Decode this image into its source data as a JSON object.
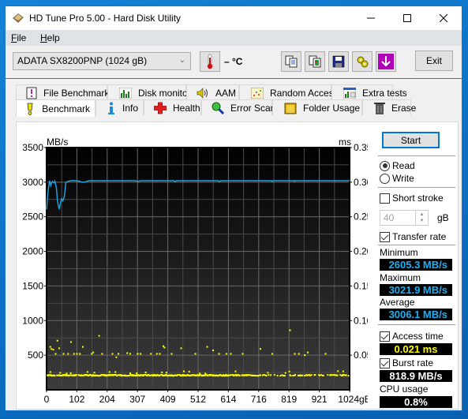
{
  "window": {
    "title": "HD Tune Pro 5.00 - Hard Disk Utility",
    "controls": {
      "minimize": "minimize",
      "maximize": "maximize",
      "close": "close"
    }
  },
  "menu": [
    {
      "label": "File",
      "accel": "F"
    },
    {
      "label": "Help",
      "accel": "H"
    }
  ],
  "toolbar": {
    "drive": "ADATA SX8200PNP (1024 gB)",
    "temperature": "– °C",
    "icons": [
      "thermometer-icon",
      "copy-text-icon",
      "copy-screenshot-icon",
      "save-icon",
      "options-icon",
      "download-icon"
    ],
    "exit_label": "Exit"
  },
  "tabs": {
    "row1": [
      "File Benchmark",
      "Disk monitor",
      "AAM",
      "Random Access",
      "Extra tests"
    ],
    "row2": [
      "Benchmark",
      "Info",
      "Health",
      "Error Scan",
      "Folder Usage",
      "Erase"
    ],
    "active": "Benchmark"
  },
  "side": {
    "start_label": "Start",
    "read_label": "Read",
    "write_label": "Write",
    "mode": "Read",
    "short_stroke_label": "Short stroke",
    "short_stroke_checked": false,
    "short_stroke_value": "40",
    "short_stroke_unit": "gB",
    "transfer_rate_label": "Transfer rate",
    "transfer_rate_checked": true,
    "minimum_label": "Minimum",
    "minimum_value": "2605.3 MB/s",
    "maximum_label": "Maximum",
    "maximum_value": "3021.9 MB/s",
    "average_label": "Average",
    "average_value": "3006.1 MB/s",
    "access_time_label": "Access time",
    "access_time_checked": true,
    "access_time_value": "0.021 ms",
    "burst_rate_label": "Burst rate",
    "burst_rate_checked": true,
    "burst_rate_value": "818.9 MB/s",
    "cpu_usage_label": "CPU usage",
    "cpu_usage_value": "0.8%"
  },
  "chart_data": {
    "type": "line",
    "left_unit": "MB/s",
    "right_unit": "ms",
    "left_ticks": [
      "3500",
      "3000",
      "2500",
      "2000",
      "1500",
      "1000",
      "500"
    ],
    "right_ticks": [
      "0.35",
      "0.30",
      "0.25",
      "0.20",
      "0.15",
      "0.10",
      "0.05"
    ],
    "x_ticks": [
      "0",
      "102",
      "204",
      "307",
      "409",
      "512",
      "614",
      "716",
      "819",
      "921",
      "1024gB"
    ],
    "ylim_left": [
      0,
      3500
    ],
    "ylim_right": [
      0,
      0.35
    ],
    "xlim": [
      0,
      1024
    ],
    "grid": true,
    "series": [
      {
        "name": "Transfer rate (MB/s)",
        "color": "#1ca0e0",
        "x": [
          0,
          3,
          5,
          8,
          10,
          14,
          17,
          20,
          25,
          28,
          33,
          37,
          40,
          43,
          47,
          51,
          55,
          60,
          65,
          70,
          80,
          90,
          100,
          110,
          120,
          128,
          135,
          142,
          150,
          200,
          250,
          300,
          311,
          316,
          330,
          400,
          430,
          434,
          438,
          520,
          560,
          580,
          584,
          588,
          760,
          762,
          764,
          836,
          838,
          840,
          1024
        ],
        "y": [
          2605,
          2780,
          2870,
          2960,
          3020,
          2950,
          2990,
          3010,
          2990,
          3015,
          2920,
          2720,
          2660,
          2610,
          2700,
          2760,
          2730,
          2790,
          2990,
          3010,
          3020,
          3025,
          3020,
          3015,
          3000,
          3000,
          3010,
          3020,
          3021,
          3021,
          3021,
          3021,
          3010,
          3021,
          3021,
          3021,
          3021,
          3005,
          3021,
          3021,
          3021,
          3021,
          3005,
          3021,
          3021,
          3010,
          3021,
          3021,
          3012,
          3021,
          3021
        ]
      },
      {
        "name": "Access time (ms)",
        "color": "#ffff00",
        "type": "scatter",
        "baseline_ms": 0.021,
        "outliers_ms": [
          [
            10,
            0.062
          ],
          [
            14,
            0.059
          ],
          [
            20,
            0.058
          ],
          [
            28,
            0.052
          ],
          [
            34,
            0.071
          ],
          [
            40,
            0.06
          ],
          [
            55,
            0.052
          ],
          [
            70,
            0.052
          ],
          [
            80,
            0.069
          ],
          [
            90,
            0.052
          ],
          [
            100,
            0.052
          ],
          [
            110,
            0.052
          ],
          [
            120,
            0.062
          ],
          [
            150,
            0.052
          ],
          [
            155,
            0.054
          ],
          [
            175,
            0.078
          ],
          [
            185,
            0.052
          ],
          [
            220,
            0.052
          ],
          [
            233,
            0.047
          ],
          [
            240,
            0.052
          ],
          [
            270,
            0.053
          ],
          [
            280,
            0.052
          ],
          [
            305,
            0.052
          ],
          [
            315,
            0.052
          ],
          [
            350,
            0.052
          ],
          [
            370,
            0.052
          ],
          [
            380,
            0.052
          ],
          [
            392,
            0.063
          ],
          [
            396,
            0.061
          ],
          [
            420,
            0.052
          ],
          [
            452,
            0.06
          ],
          [
            500,
            0.052
          ],
          [
            540,
            0.062
          ],
          [
            560,
            0.057
          ],
          [
            580,
            0.052
          ],
          [
            605,
            0.052
          ],
          [
            620,
            0.052
          ],
          [
            660,
            0.052
          ],
          [
            720,
            0.059
          ],
          [
            760,
            0.052
          ],
          [
            820,
            0.086
          ],
          [
            836,
            0.052
          ],
          [
            850,
            0.052
          ],
          [
            870,
            0.05
          ],
          [
            880,
            0.054
          ],
          [
            940,
            0.052
          ]
        ],
        "secondary_band_ms": 0.025
      }
    ]
  }
}
